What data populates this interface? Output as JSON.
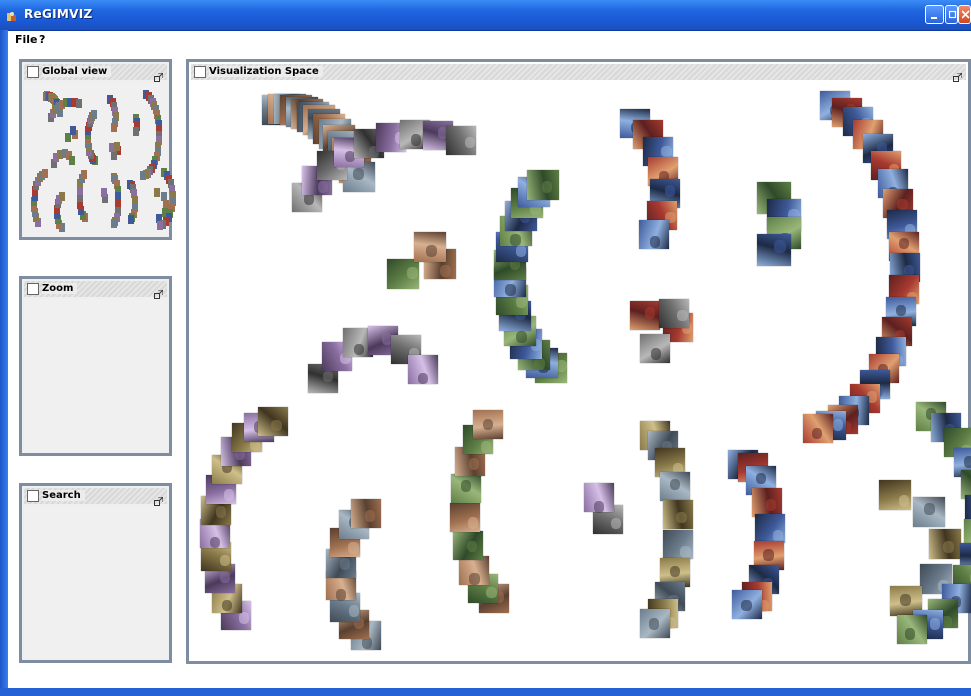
{
  "window": {
    "title": "ReGIMVIZ",
    "app_icon": "app-icon",
    "controls": [
      "minimize-icon",
      "restore-icon",
      "close-icon"
    ]
  },
  "menu": {
    "items": [
      "File",
      "?"
    ]
  },
  "panels": {
    "global_view": {
      "title": "Global view"
    },
    "zoom": {
      "title": "Zoom"
    },
    "search": {
      "title": "Search"
    },
    "visualization": {
      "title": "Visualization Space"
    }
  },
  "colors": {
    "title_bar": "#1f66e0",
    "panel_border": "#7f8da3",
    "panel_background": "#efefef",
    "canvas_background": "#ffffff"
  }
}
